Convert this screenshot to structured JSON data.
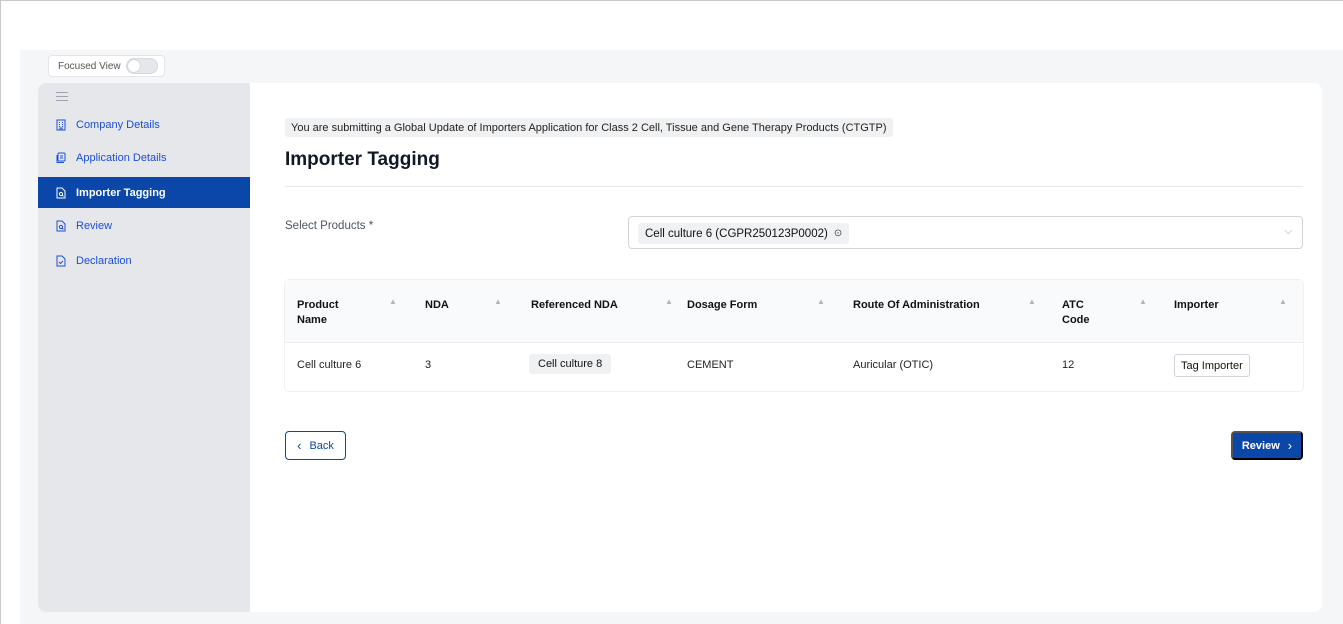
{
  "focused_view": {
    "label": "Focused View",
    "enabled": false
  },
  "sidebar": {
    "items": [
      {
        "label": "Company Details",
        "icon": "building-icon",
        "active": false
      },
      {
        "label": "Application Details",
        "icon": "copy-document-icon",
        "active": false
      },
      {
        "label": "Importer Tagging",
        "icon": "document-search-icon",
        "active": true
      },
      {
        "label": "Review",
        "icon": "document-search-icon",
        "active": false
      },
      {
        "label": "Declaration",
        "icon": "document-check-icon",
        "active": false
      }
    ]
  },
  "main": {
    "notice": "You are submitting a Global Update of Importers Application for Class 2 Cell, Tissue and Gene Therapy Products (CTGTP)",
    "title": "Importer Tagging",
    "select_products": {
      "label": "Select Products *",
      "selected": "Cell culture 6 (CGPR250123P0002)"
    },
    "table": {
      "columns": [
        "Product Name",
        "NDA",
        "Referenced NDA",
        "Dosage Form",
        "Route Of Administration",
        "ATC Code",
        "Importer"
      ],
      "rows": [
        {
          "product_name": "Cell culture 6",
          "nda": "3",
          "referenced_nda": "Cell culture 8",
          "dosage_form": "CEMENT",
          "route": "Auricular (OTIC)",
          "atc_code": "12",
          "importer_action": "Tag Importer"
        }
      ]
    },
    "buttons": {
      "back": "Back",
      "review": "Review"
    }
  },
  "colors": {
    "primary": "#0b46a9",
    "sidebar_bg": "#e5e7eb",
    "canvas_bg": "#f5f6f8"
  }
}
